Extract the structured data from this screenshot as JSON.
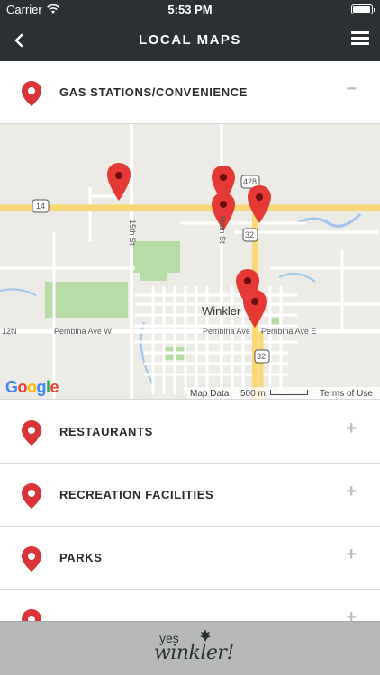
{
  "status_bar": {
    "carrier": "Carrier",
    "time": "5:53 PM"
  },
  "nav": {
    "title": "LOCAL MAPS",
    "back_icon": "chevron-left-icon",
    "menu_icon": "hamburger-menu-icon"
  },
  "sections": [
    {
      "label": "GAS STATIONS/CONVENIENCE",
      "toggle": "−",
      "expanded": true
    },
    {
      "label": "RESTAURANTS",
      "toggle": "+",
      "expanded": false
    },
    {
      "label": "RECREATION FACILITIES",
      "toggle": "+",
      "expanded": false
    },
    {
      "label": "PARKS",
      "toggle": "+",
      "expanded": false
    },
    {
      "label": "",
      "toggle": "+",
      "expanded": false
    }
  ],
  "map": {
    "labels": {
      "hwy14": "14",
      "hwy428": "428",
      "hwy32_north": "32",
      "hwy32_south": "32",
      "street_15th": "15th St",
      "street_main": "Main St",
      "town": "Winkler",
      "pembina_w": "Pembina Ave W",
      "pembina": "Pembina Ave",
      "pembina_e": "Pembina Ave E",
      "road_12n": "12N"
    },
    "google_logo": [
      "G",
      "o",
      "o",
      "g",
      "l",
      "e"
    ],
    "map_data": "Map Data",
    "scale": "500 m",
    "terms": "Terms of Use",
    "pin_color": "#e53935"
  },
  "footer": {
    "logo_top": "yes",
    "logo_main": "winkler!"
  },
  "colors": {
    "header_bg": "#2b3135",
    "pin_red": "#d9343a",
    "footer_bg": "#b7b8b8"
  }
}
